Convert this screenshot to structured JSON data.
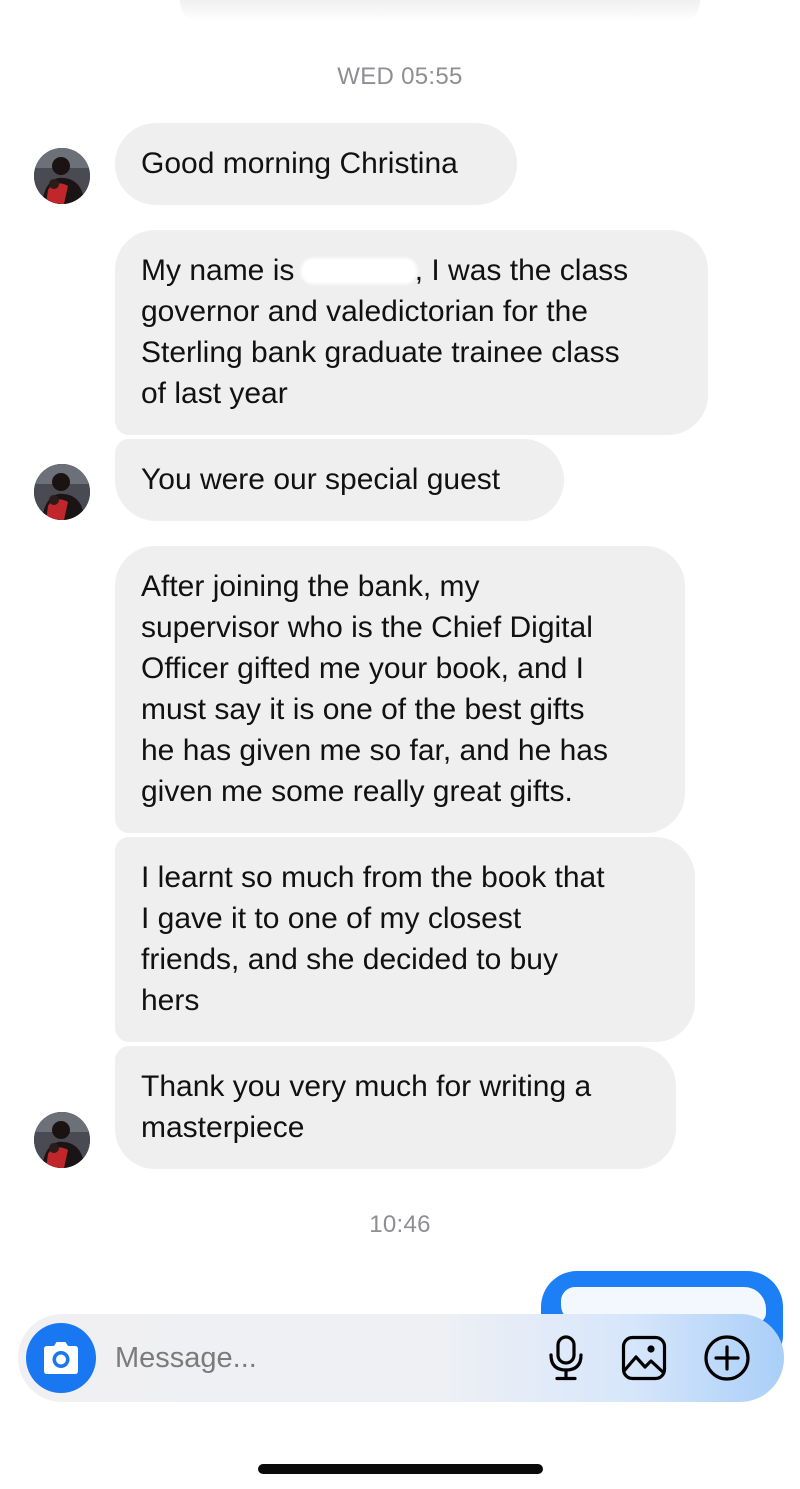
{
  "conversation": {
    "timestamps": {
      "first": "WED 05:55",
      "second": "10:46"
    },
    "messages": [
      {
        "text": "Good morning Christina"
      },
      {
        "prefix": "My name is ",
        "suffix": ", I was the class\ngovernor and valedictorian for the\nSterling bank graduate trainee class\nof last year"
      },
      {
        "text": "You were our special guest"
      },
      {
        "text": "After joining the bank, my\nsupervisor who is the Chief Digital\nOfficer gifted me your book, and I\nmust say it is one of the best gifts\nhe has given me so far, and he has\ngiven me some really great gifts."
      },
      {
        "text": "I learnt so much from the book that\nI gave it to one of my closest\nfriends, and she decided to buy\nhers"
      },
      {
        "text": "Thank you very much for writing a\nmasterpiece"
      }
    ]
  },
  "composer": {
    "placeholder": "Message...",
    "icons": [
      "camera-icon",
      "microphone-icon",
      "gallery-icon",
      "add-icon"
    ]
  },
  "colors": {
    "accent": "#1a77f2",
    "bubble_received": "#efefef",
    "bubble_sent": "#1d7ff5",
    "timestamp": "#8e8e93"
  }
}
